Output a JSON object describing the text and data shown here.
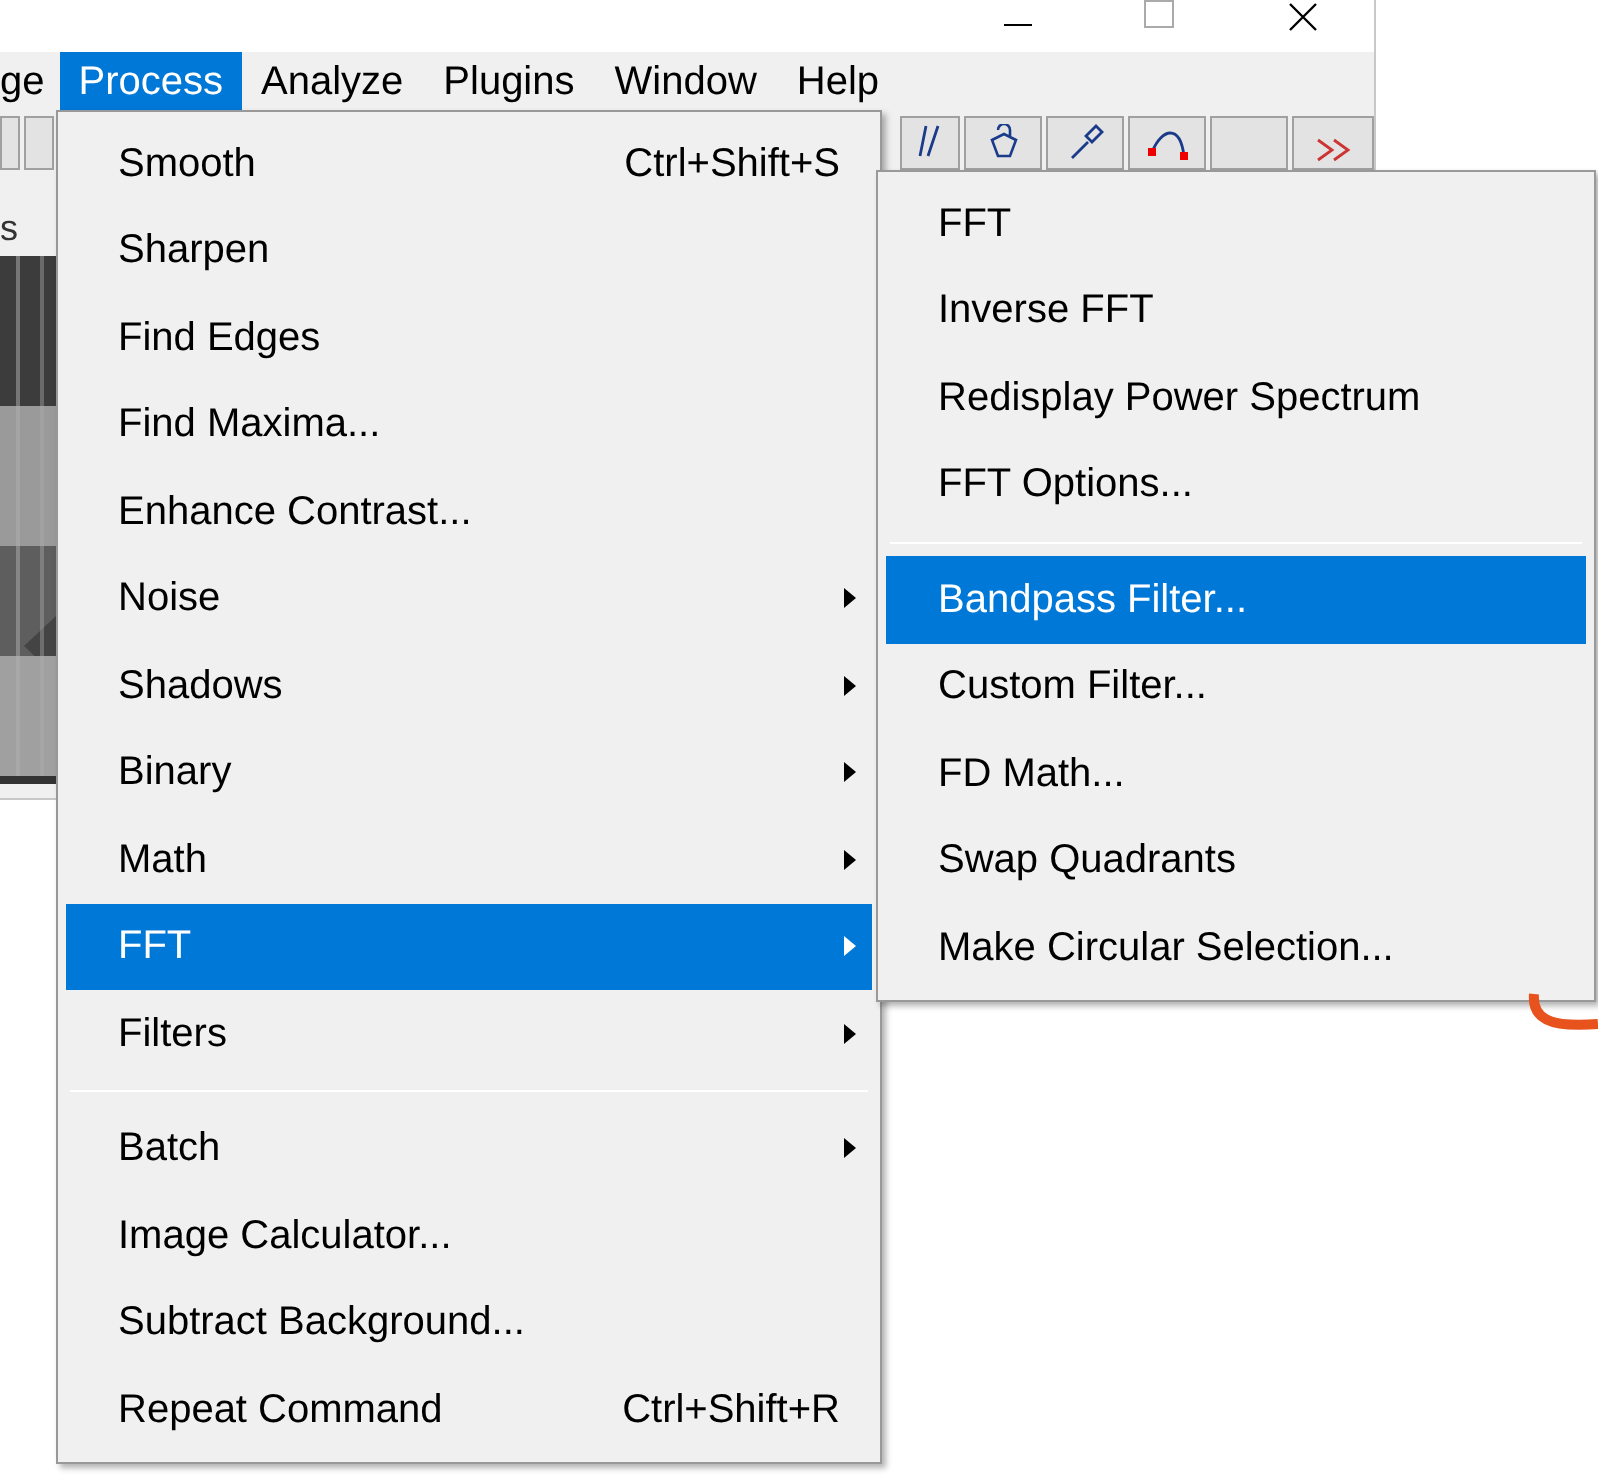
{
  "window": {
    "menubar": [
      {
        "label": "ge",
        "selected": false
      },
      {
        "label": "Process",
        "selected": true
      },
      {
        "label": "Analyze",
        "selected": false
      },
      {
        "label": "Plugins",
        "selected": false
      },
      {
        "label": "Window",
        "selected": false
      },
      {
        "label": "Help",
        "selected": false
      }
    ],
    "status_text": "s"
  },
  "process_menu": {
    "items": [
      {
        "kind": "item",
        "label": "Smooth",
        "shortcut": "Ctrl+Shift+S",
        "submenu": false,
        "selected": false
      },
      {
        "kind": "item",
        "label": "Sharpen",
        "submenu": false,
        "selected": false
      },
      {
        "kind": "item",
        "label": "Find Edges",
        "submenu": false,
        "selected": false
      },
      {
        "kind": "item",
        "label": "Find Maxima...",
        "submenu": false,
        "selected": false
      },
      {
        "kind": "item",
        "label": "Enhance Contrast...",
        "submenu": false,
        "selected": false
      },
      {
        "kind": "item",
        "label": "Noise",
        "submenu": true,
        "selected": false
      },
      {
        "kind": "item",
        "label": "Shadows",
        "submenu": true,
        "selected": false
      },
      {
        "kind": "item",
        "label": "Binary",
        "submenu": true,
        "selected": false
      },
      {
        "kind": "item",
        "label": "Math",
        "submenu": true,
        "selected": false
      },
      {
        "kind": "item",
        "label": "FFT",
        "submenu": true,
        "selected": true
      },
      {
        "kind": "item",
        "label": "Filters",
        "submenu": true,
        "selected": false
      },
      {
        "kind": "separator"
      },
      {
        "kind": "item",
        "label": "Batch",
        "submenu": true,
        "selected": false
      },
      {
        "kind": "item",
        "label": "Image Calculator...",
        "submenu": false,
        "selected": false
      },
      {
        "kind": "item",
        "label": "Subtract Background...",
        "submenu": false,
        "selected": false
      },
      {
        "kind": "item",
        "label": "Repeat Command",
        "shortcut": "Ctrl+Shift+R",
        "submenu": false,
        "selected": false
      }
    ]
  },
  "fft_submenu": {
    "items": [
      {
        "kind": "item",
        "label": "FFT",
        "selected": false
      },
      {
        "kind": "item",
        "label": "Inverse FFT",
        "selected": false
      },
      {
        "kind": "item",
        "label": "Redisplay Power Spectrum",
        "selected": false
      },
      {
        "kind": "item",
        "label": "FFT Options...",
        "selected": false
      },
      {
        "kind": "separator"
      },
      {
        "kind": "item",
        "label": "Bandpass Filter...",
        "selected": true
      },
      {
        "kind": "item",
        "label": "Custom Filter...",
        "selected": false
      },
      {
        "kind": "item",
        "label": "FD Math...",
        "selected": false
      },
      {
        "kind": "item",
        "label": "Swap Quadrants",
        "selected": false
      },
      {
        "kind": "item",
        "label": "Make Circular Selection...",
        "selected": false
      }
    ]
  }
}
